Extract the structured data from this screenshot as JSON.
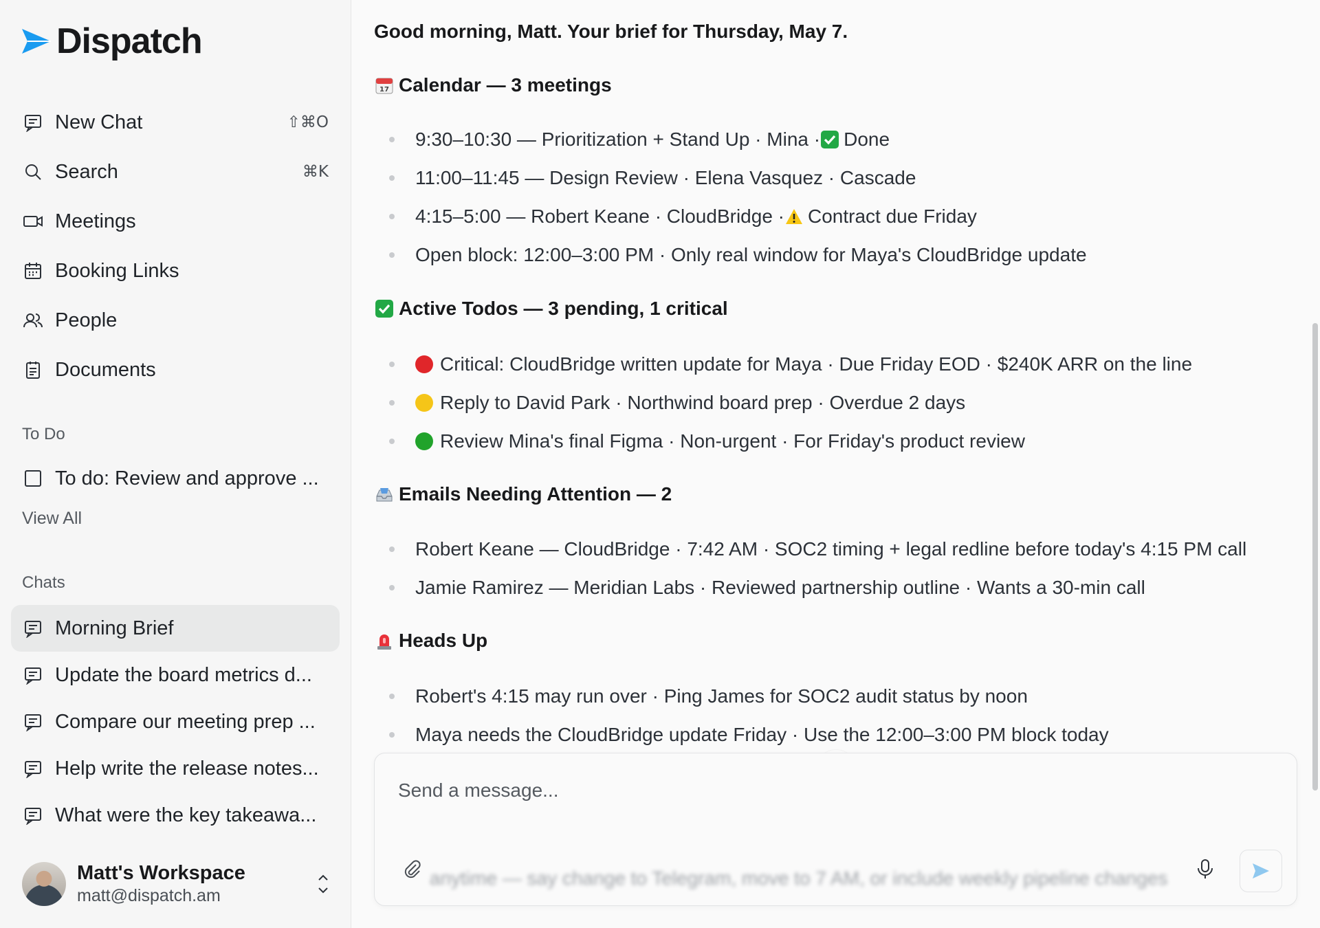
{
  "brand": {
    "name": "Dispatch",
    "accent": "#1a9bf0"
  },
  "nav": [
    {
      "label": "New Chat",
      "icon": "chat-icon",
      "shortcut": "⇧⌘O"
    },
    {
      "label": "Search",
      "icon": "search-icon",
      "shortcut": "⌘K"
    },
    {
      "label": "Meetings",
      "icon": "video-icon",
      "shortcut": ""
    },
    {
      "label": "Booking Links",
      "icon": "calendar-icon",
      "shortcut": ""
    },
    {
      "label": "People",
      "icon": "people-icon",
      "shortcut": ""
    },
    {
      "label": "Documents",
      "icon": "document-icon",
      "shortcut": ""
    }
  ],
  "todo": {
    "section_label": "To Do",
    "items": [
      {
        "label": "To do: Review and approve ..."
      }
    ],
    "view_all": "View All"
  },
  "chats": {
    "section_label": "Chats",
    "items": [
      {
        "label": "Morning Brief",
        "active": true
      },
      {
        "label": "Update the board metrics d...",
        "active": false
      },
      {
        "label": "Compare our meeting prep ...",
        "active": false
      },
      {
        "label": "Help write the release notes...",
        "active": false
      },
      {
        "label": "What were the key takeawa...",
        "active": false
      }
    ]
  },
  "workspace": {
    "name": "Matt's Workspace",
    "email": "matt@dispatch.am"
  },
  "brief": {
    "greeting": "Good morning, Matt. Your brief for Thursday, May 7.",
    "calendar": {
      "heading": "Calendar — 3 meetings",
      "items": [
        {
          "text": "9:30–10:30 — Prioritization + Stand Up · Mina · ",
          "suffix": "Done"
        },
        {
          "text": "11:00–11:45 — Design Review · Elena Vasquez · Cascade"
        },
        {
          "text": "4:15–5:00 — Robert Keane · CloudBridge · ",
          "suffix": "Contract due Friday"
        },
        {
          "text": "Open block: 12:00–3:00 PM · Only real window for Maya's CloudBridge update"
        }
      ]
    },
    "todos": {
      "heading": "Active Todos — 3 pending, 1 critical",
      "items": [
        {
          "text": "Critical: CloudBridge written update for Maya · Due Friday EOD · $240K ARR on the line",
          "color": "#e0262a"
        },
        {
          "text": "Reply to David Park · Northwind board prep · Overdue 2 days",
          "color": "#f5c518"
        },
        {
          "text": "Review Mina's final Figma · Non-urgent · For Friday's product review",
          "color": "#21a32b"
        }
      ]
    },
    "emails": {
      "heading": "Emails Needing Attention — 2",
      "items": [
        {
          "text": "Robert Keane — CloudBridge · 7:42 AM · SOC2 timing + legal redline before today's 4:15 PM call"
        },
        {
          "text": "Jamie Ramirez — Meridian Labs · Reviewed partnership outline · Wants a 30-min call"
        }
      ]
    },
    "heads_up": {
      "heading": "Heads Up",
      "items": [
        {
          "text": "Robert's 4:15 may run over · Ping James for SOC2 audit status by noon"
        },
        {
          "text": "Maya needs the CloudBridge update Friday · Use the 12:00–3:00 PM block today"
        }
      ]
    }
  },
  "composer": {
    "placeholder": "Send a message...",
    "hint": "anytime — say change to Telegram, move to 7 AM, or include weekly pipeline changes"
  }
}
